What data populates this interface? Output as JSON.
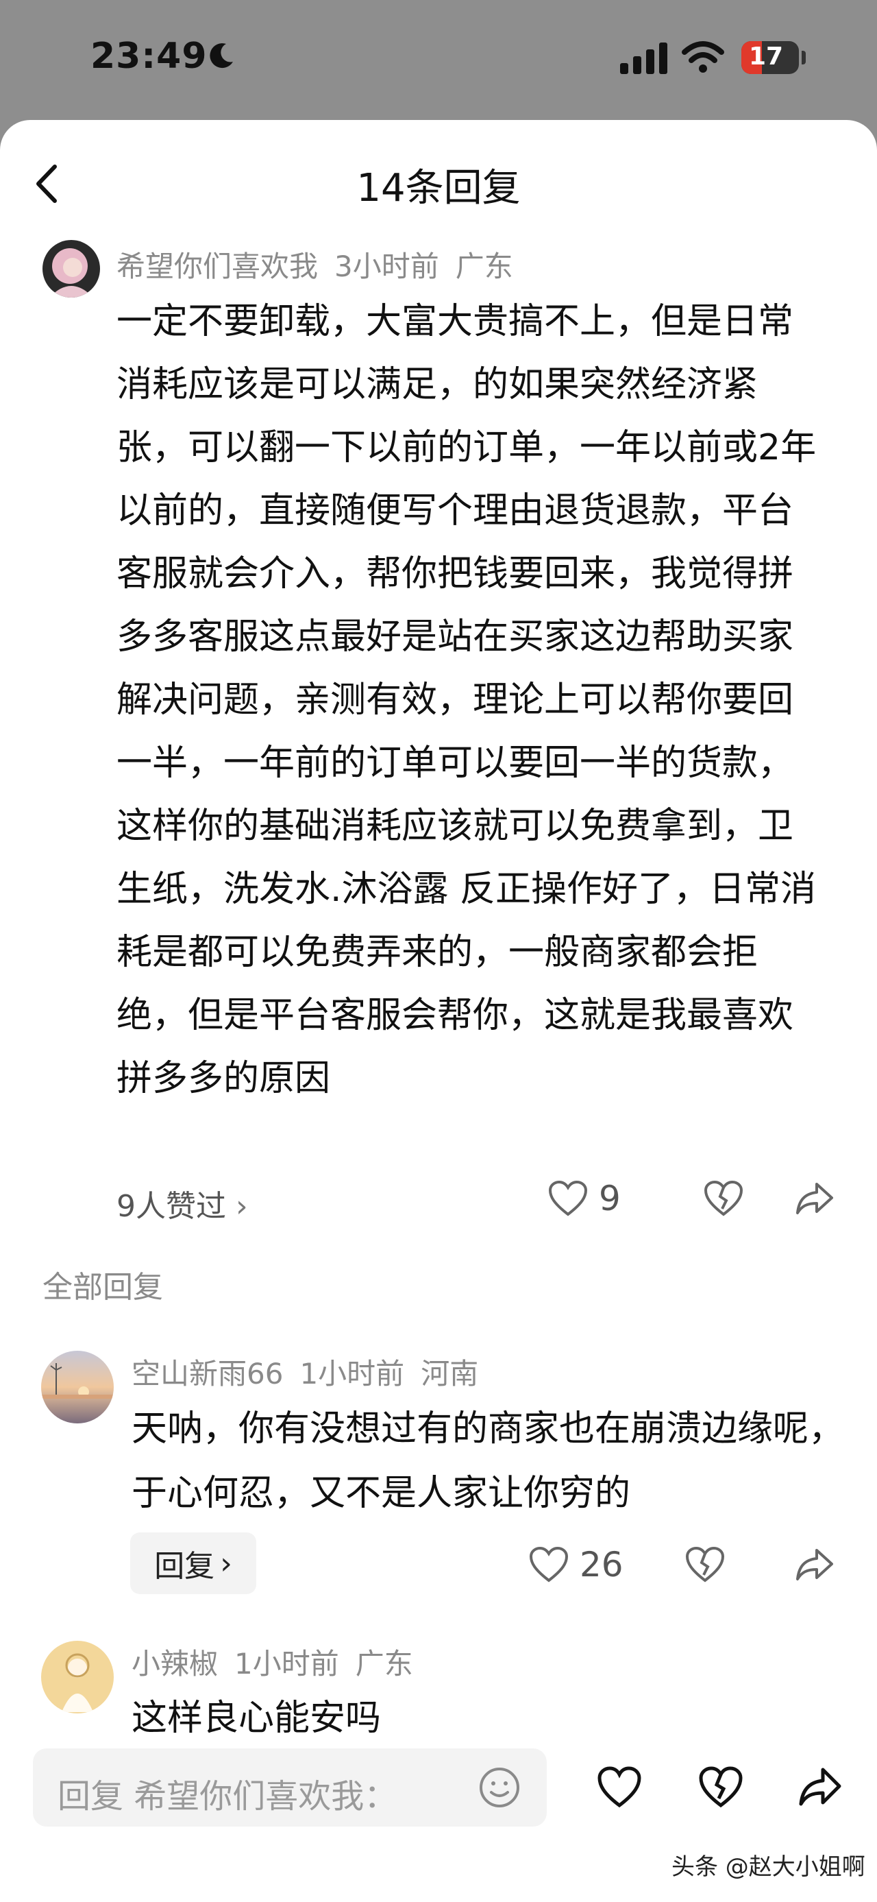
{
  "status_bar": {
    "time": "23:49",
    "battery": "17"
  },
  "header": {
    "title": "14条回复"
  },
  "main_comment": {
    "username": "希望你们喜欢我",
    "time": "3小时前",
    "location": "广东",
    "text": "一定不要卸载，大富大贵搞不上，但是日常消耗应该是可以满足，的如果突然经济紧张，可以翻一下以前的订单，一年以前或2年以前的，直接随便写个理由退货退款，平台客服就会介入，帮你把钱要回来，我觉得拼多多客服这点最好是站在买家这边帮助买家解决问题，亲测有效，理论上可以帮你要回一半，一年前的订单可以要回一半的货款，这样你的基础消耗应该就可以免费拿到，卫生纸，洗发水.沐浴露 反正操作好了，日常消耗是都可以免费弄来的，一般商家都会拒绝，但是平台客服会帮你，这就是我最喜欢拼多多的原因",
    "likes_link": "9人赞过",
    "like_count": "9"
  },
  "section_label": "全部回复",
  "replies": [
    {
      "username": "空山新雨66",
      "time": "1小时前",
      "location": "河南",
      "text": "天呐，你有没想过有的商家也在崩溃边缘呢，于心何忍，又不是人家让你穷的",
      "reply_label": "回复",
      "like_count": "26"
    },
    {
      "username": "小辣椒",
      "time": "1小时前",
      "location": "广东",
      "text": "这样良心能安吗"
    }
  ],
  "input": {
    "placeholder": "回复 希望你们喜欢我："
  },
  "watermark": "头条 @赵大小姐啊",
  "icons": {
    "back": "chevron-left-icon",
    "like": "heart-icon",
    "dislike": "broken-heart-icon",
    "share": "share-arrow-icon",
    "emoji": "smiley-icon"
  }
}
